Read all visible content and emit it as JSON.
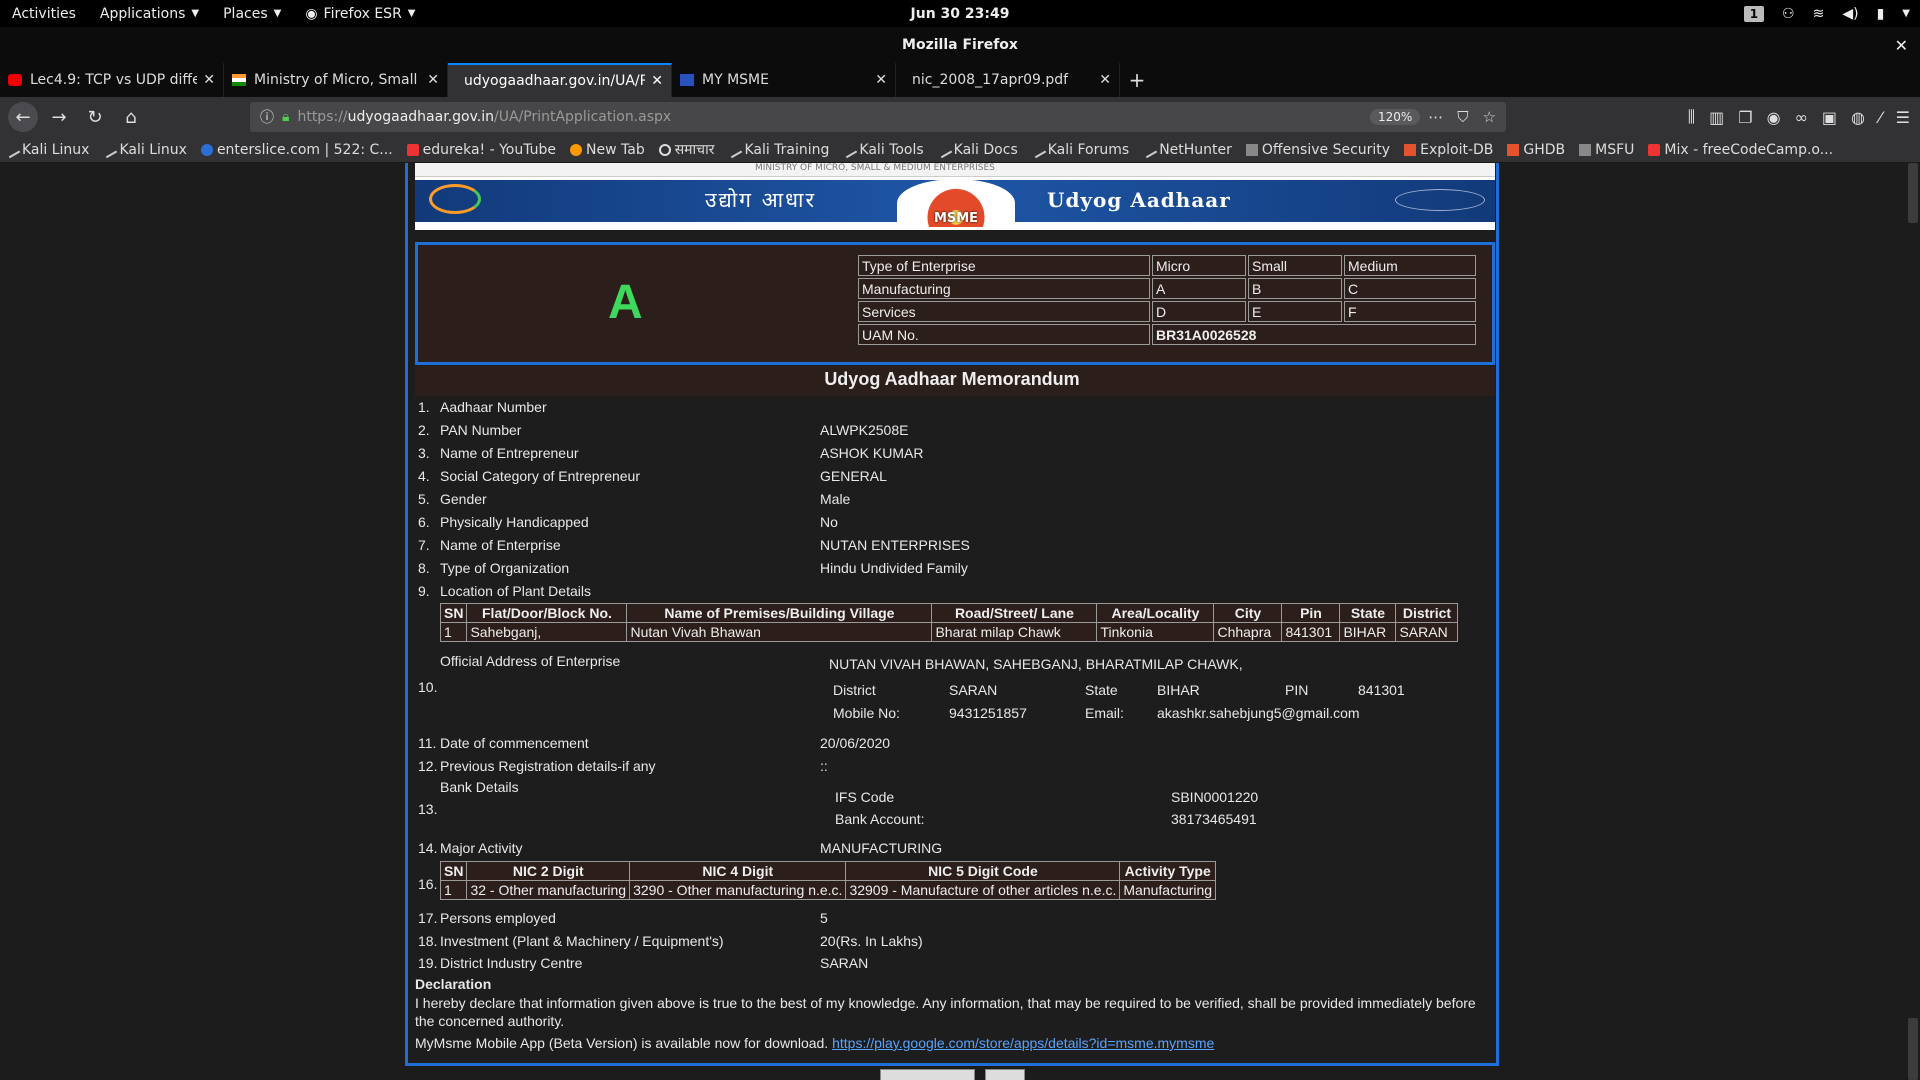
{
  "topbar": {
    "activities": "Activities",
    "applications": "Applications",
    "places": "Places",
    "firefox": "Firefox ESR",
    "clock": "Jun 30  23:49",
    "workspace": "1"
  },
  "window": {
    "title": "Mozilla Firefox"
  },
  "tabs": [
    {
      "title": "Lec4.9: TCP vs UDP diffe",
      "icon": "youtube-icon"
    },
    {
      "title": "Ministry of Micro, Small &",
      "icon": "india-flag-icon"
    },
    {
      "title": "udyogaadhaar.gov.in/UA/Pr",
      "icon": "none"
    },
    {
      "title": "MY MSME",
      "icon": "msme-icon"
    },
    {
      "title": "nic_2008_17apr09.pdf",
      "icon": "none"
    }
  ],
  "navbar": {
    "url_prefix": "https://",
    "url_host": "udyogaadhaar.gov.in",
    "url_path": "/UA/PrintApplication.aspx",
    "zoom": "120%"
  },
  "bookmarks": [
    "Kali Linux",
    "Kali Linux",
    "enterslice.com | 522: C...",
    "edureka! - YouTube",
    "New Tab",
    "समाचार",
    "Kali Training",
    "Kali Tools",
    "Kali Docs",
    "Kali Forums",
    "NetHunter",
    "Offensive Security",
    "Exploit-DB",
    "GHDB",
    "MSFU",
    "Mix - freeCodeCamp.o..."
  ],
  "banner": {
    "strip": "MINISTRY OF MICRO, SMALL & MEDIUM ENTERPRISES",
    "hindi": "उद्योग आधार",
    "english": "Udyog Aadhaar",
    "seal": "MSME",
    "left_logo": "Digital India"
  },
  "classification": {
    "grade": "A",
    "headers": [
      "Type of Enterprise",
      "Micro",
      "Small",
      "Medium"
    ],
    "manufacturing": [
      "Manufacturing",
      "A",
      "B",
      "C"
    ],
    "services": [
      "Services",
      "D",
      "E",
      "F"
    ],
    "uam_label": "UAM No.",
    "uam_value": "BR31A0026528"
  },
  "memo_title": "Udyog Aadhaar Memorandum",
  "rows": [
    {
      "num": "1.",
      "label": "Aadhaar Number",
      "value": ""
    },
    {
      "num": "2.",
      "label": "PAN Number",
      "value": "ALWPK2508E"
    },
    {
      "num": "3.",
      "label": "Name of Entrepreneur",
      "value": "ASHOK KUMAR"
    },
    {
      "num": "4.",
      "label": "Social Category of Entrepreneur",
      "value": "GENERAL"
    },
    {
      "num": "5.",
      "label": "Gender",
      "value": "Male"
    },
    {
      "num": "6.",
      "label": "Physically Handicapped",
      "value": "No"
    },
    {
      "num": "7.",
      "label": "Name of Enterprise",
      "value": "NUTAN ENTERPRISES"
    },
    {
      "num": "8.",
      "label": "Type of Organization",
      "value": "Hindu Undivided Family"
    },
    {
      "num": "9.",
      "label": "Location of Plant Details",
      "value": ""
    }
  ],
  "plant_table": {
    "headers": [
      "SN",
      "Flat/Door/Block No.",
      "Name of Premises/Building Village",
      "Road/Street/ Lane",
      "Area/Locality",
      "City",
      "Pin",
      "State",
      "District"
    ],
    "rows": [
      [
        "1",
        "Sahebganj,",
        "Nutan Vivah Bhawan",
        "Bharat milap Chawk",
        "Tinkonia",
        "Chhapra",
        "841301",
        "BIHAR",
        "SARAN"
      ]
    ]
  },
  "address": {
    "num": "10.",
    "label": "Official Address of Enterprise",
    "line1": "NUTAN VIVAH BHAWAN, SAHEBGANJ, BHARATMILAP CHAWK,",
    "district_label": "District",
    "district": "SARAN",
    "state_label": "State",
    "state": "BIHAR",
    "pin_label": "PIN",
    "pin": "841301",
    "mobile_label": "Mobile No:",
    "mobile": "9431251857",
    "email_label": "Email:",
    "email": "akashkr.sahebjung5@gmail.com"
  },
  "rows2": [
    {
      "num": "11.",
      "label": "Date of commencement",
      "value": "20/06/2020"
    },
    {
      "num": "12.",
      "label": "Previous Registration details-if any",
      "value": "::"
    }
  ],
  "bank": {
    "num": "13.",
    "label": "Bank Details",
    "ifs_label": "IFS Code",
    "ifs": "SBIN0001220",
    "acct_label": "Bank Account:",
    "acct": "38173465491"
  },
  "major_activity": {
    "num": "14.",
    "label": "Major Activity",
    "value": "MANUFACTURING"
  },
  "nic_table": {
    "num": "16.",
    "headers": [
      "SN",
      "NIC 2 Digit",
      "NIC 4 Digit",
      "NIC 5 Digit Code",
      "Activity Type"
    ],
    "rows": [
      [
        "1",
        "32 - Other manufacturing",
        "3290 - Other manufacturing n.e.c.",
        "32909 - Manufacture of other articles n.e.c.",
        "Manufacturing"
      ]
    ]
  },
  "rows3": [
    {
      "num": "17.",
      "label": "Persons employed",
      "value": "5"
    },
    {
      "num": "18.",
      "label": "Investment (Plant & Machinery / Equipment's)",
      "value": "20(Rs. In Lakhs)"
    },
    {
      "num": "19.",
      "label": "District Industry Centre",
      "value": "SARAN"
    }
  ],
  "declaration": {
    "title": "Declaration",
    "text": "I hereby declare that information given above is true to the best of my knowledge. Any information, that may be required to be verified, shall be provided immediately before the concerned authority.",
    "app_text": "MyMsme Mobile App (Beta Version) is available now for download.",
    "app_link": "https://play.google.com/store/apps/details?id=msme.mymsme"
  },
  "colors": {
    "accent": "#1f6fd9",
    "grade": "#3ed85c",
    "uam": "#ff3b30",
    "link": "#5aa3ff"
  }
}
